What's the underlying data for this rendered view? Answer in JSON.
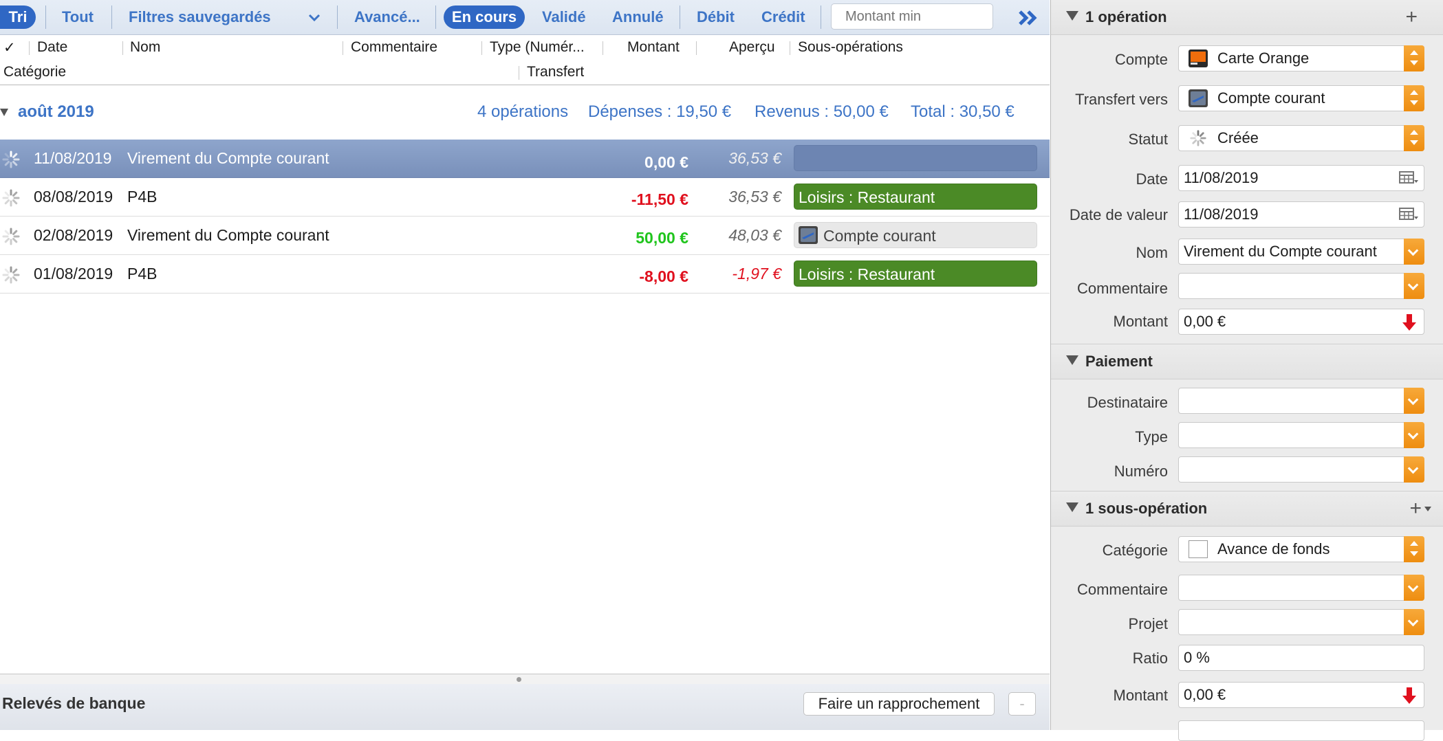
{
  "filterbar": {
    "tri": "Tri",
    "tout": "Tout",
    "saved_filters": "Filtres sauvegardés",
    "advanced": "Avancé...",
    "en_cours": "En cours",
    "valide": "Validé",
    "annule": "Annulé",
    "debit": "Débit",
    "credit": "Crédit",
    "amount_min_placeholder": "Montant min"
  },
  "columns": {
    "check": "✓",
    "date": "Date",
    "nom": "Nom",
    "commentaire": "Commentaire",
    "type": "Type (Numér...",
    "montant": "Montant",
    "apercu": "Aperçu",
    "sous_operations": "Sous-opérations",
    "categorie": "Catégorie",
    "transfert": "Transfert"
  },
  "group": {
    "month": "août 2019",
    "count": "4 opérations",
    "depenses": "Dépenses : 19,50 €",
    "revenus": "Revenus : 50,00 €",
    "total": "Total : 30,50 €"
  },
  "transactions": [
    {
      "date": "11/08/2019",
      "name": "Virement du Compte courant",
      "amount": "0,00 €",
      "balance": "36,53 €",
      "tag": ""
    },
    {
      "date": "08/08/2019",
      "name": "P4B",
      "amount": "-11,50 €",
      "balance": "36,53 €",
      "tag": "Loisirs : Restaurant"
    },
    {
      "date": "02/08/2019",
      "name": "Virement du Compte courant",
      "amount": "50,00 €",
      "balance": "48,03 €",
      "tag": "Compte courant"
    },
    {
      "date": "01/08/2019",
      "name": "P4B",
      "amount": "-8,00 €",
      "balance": "-1,97 €",
      "tag": "Loisirs : Restaurant"
    }
  ],
  "bottombar": {
    "title": "Relevés de banque",
    "reconcile": "Faire un rapprochement",
    "minus": "-"
  },
  "inspector": {
    "operation": {
      "title": "1 opération",
      "plus": "+",
      "compte_label": "Compte",
      "compte_value": "Carte Orange",
      "transfert_label": "Transfert vers",
      "transfert_value": "Compte courant",
      "statut_label": "Statut",
      "statut_value": "Créée",
      "date_label": "Date",
      "date_value": "11/08/2019",
      "date_valeur_label": "Date de valeur",
      "date_valeur_value": "11/08/2019",
      "nom_label": "Nom",
      "nom_value": "Virement du Compte courant",
      "commentaire_label": "Commentaire",
      "commentaire_value": "",
      "montant_label": "Montant",
      "montant_value": "0,00 €"
    },
    "paiement": {
      "title": "Paiement",
      "destinataire_label": "Destinataire",
      "type_label": "Type",
      "numero_label": "Numéro"
    },
    "sous_operation": {
      "title": "1 sous-opération",
      "plus": "+",
      "categorie_label": "Catégorie",
      "categorie_value": "Avance de fonds",
      "commentaire_label": "Commentaire",
      "projet_label": "Projet",
      "ratio_label": "Ratio",
      "ratio_value": "0 %",
      "montant_label": "Montant",
      "montant_value": "0,00 €"
    }
  },
  "colors": {
    "accent": "#3d74c6",
    "selected_row": "#8ea5cc",
    "negative": "#e0101e",
    "positive": "#20c51d",
    "tag_green": "#4b8a26",
    "stepper_orange": "#f29b22"
  }
}
